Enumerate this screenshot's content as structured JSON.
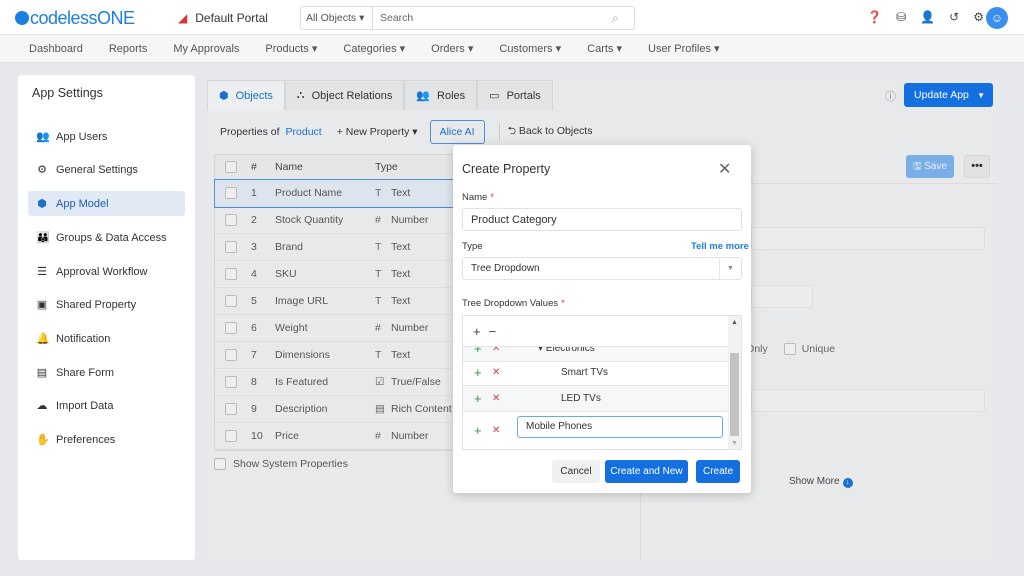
{
  "header": {
    "logo": "codelessONE",
    "portal": "Default Portal",
    "search_scope": "All Objects",
    "search_placeholder": "Search",
    "icons": [
      "help-icon",
      "database-icon",
      "add-user-icon",
      "history-icon",
      "gear-icon",
      "user-avatar-icon"
    ]
  },
  "nav": [
    {
      "label": "Dashboard"
    },
    {
      "label": "Reports"
    },
    {
      "label": "My Approvals"
    },
    {
      "label": "Products ▾"
    },
    {
      "label": "Categories ▾"
    },
    {
      "label": "Orders ▾"
    },
    {
      "label": "Customers ▾"
    },
    {
      "label": "Carts ▾"
    },
    {
      "label": "User Profiles ▾"
    }
  ],
  "sidebar": {
    "title": "App Settings",
    "items": [
      {
        "label": "App Users",
        "icon": "👥"
      },
      {
        "label": "General Settings",
        "icon": "⚙"
      },
      {
        "label": "App Model",
        "icon": "⬢"
      },
      {
        "label": "Groups & Data Access",
        "icon": "👪"
      },
      {
        "label": "Approval Workflow",
        "icon": "☰"
      },
      {
        "label": "Shared Property",
        "icon": "▣"
      },
      {
        "label": "Notification",
        "icon": "🔔"
      },
      {
        "label": "Share Form",
        "icon": "▤"
      },
      {
        "label": "Import Data",
        "icon": "☁"
      },
      {
        "label": "Preferences",
        "icon": "✋"
      }
    ],
    "active": "App Model"
  },
  "tabs": [
    {
      "label": "Objects",
      "icon": "⬢"
    },
    {
      "label": "Object Relations",
      "icon": "⛬"
    },
    {
      "label": "Roles",
      "icon": "👥"
    },
    {
      "label": "Portals",
      "icon": "▭"
    }
  ],
  "update_app": "Update App",
  "toolbar": {
    "properties_of": "Properties of",
    "object": "Product",
    "new_property": "+ New Property ▾",
    "alice": "Alice AI",
    "back": "⮌ Back to Objects"
  },
  "table": {
    "headers": [
      "#",
      "Name",
      "Type"
    ],
    "rows": [
      {
        "n": "1",
        "name": "Product Name",
        "ti": "T",
        "type": "Text"
      },
      {
        "n": "2",
        "name": "Stock Quantity",
        "ti": "#",
        "type": "Number"
      },
      {
        "n": "3",
        "name": "Brand",
        "ti": "T",
        "type": "Text"
      },
      {
        "n": "4",
        "name": "SKU",
        "ti": "T",
        "type": "Text"
      },
      {
        "n": "5",
        "name": "Image URL",
        "ti": "T",
        "type": "Text"
      },
      {
        "n": "6",
        "name": "Weight",
        "ti": "#",
        "type": "Number"
      },
      {
        "n": "7",
        "name": "Dimensions",
        "ti": "T",
        "type": "Text"
      },
      {
        "n": "8",
        "name": "Is Featured",
        "ti": "☑",
        "type": "True/False"
      },
      {
        "n": "9",
        "name": "Description",
        "ti": "▤",
        "type": "Rich Content"
      },
      {
        "n": "10",
        "name": "Price",
        "ti": "#",
        "type": "Number"
      }
    ]
  },
  "show_system": "Show System Properties",
  "right": {
    "save": "🖫 Save",
    "more": "•••",
    "readonly": "ad-Only",
    "unique": "Unique",
    "show_more": "Show More"
  },
  "modal": {
    "title": "Create Property",
    "name_label": "Name",
    "name_value": "Product Category",
    "type_label": "Type",
    "tell_me_more": "Tell me more",
    "type_value": "Tree Dropdown",
    "values_label": "Tree Dropdown Values",
    "tree": [
      {
        "label": "▾ Electronics"
      },
      {
        "label": "Smart TVs"
      },
      {
        "label": "LED TVs"
      }
    ],
    "editing_value": "Mobile Phones",
    "cancel": "Cancel",
    "create_new": "Create and New",
    "create": "Create"
  }
}
